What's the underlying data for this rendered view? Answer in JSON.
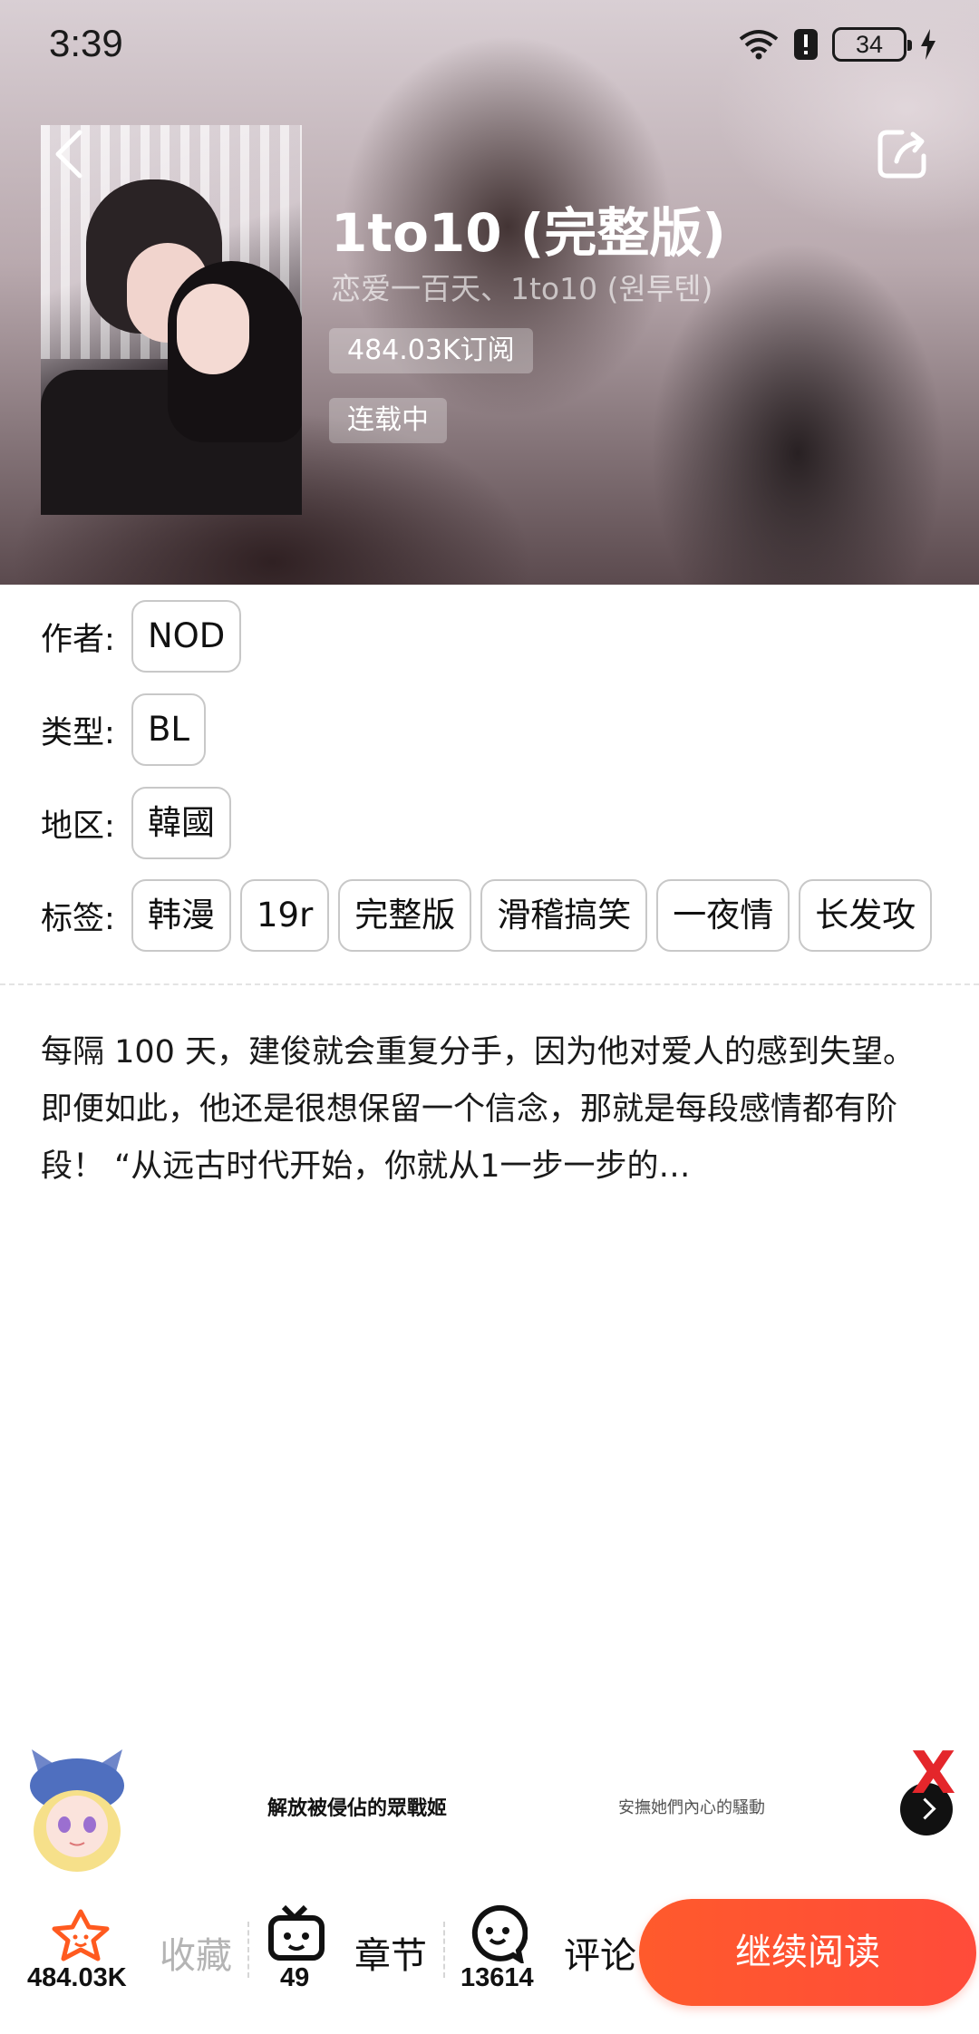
{
  "status_bar": {
    "time": "3:39",
    "battery": "34"
  },
  "header": {
    "title": "1to10 (完整版)",
    "alt_titles": "恋爱一百天、1to10 (원투텐)",
    "subscriptions": "484.03K订阅",
    "status": "连载中",
    "back_icon": "chevron-left-icon",
    "share_icon": "share-icon"
  },
  "meta": {
    "author_label": "作者:",
    "author": "NOD",
    "type_label": "类型:",
    "type": "BL",
    "region_label": "地区:",
    "region": "韓國",
    "tags_label": "标签:",
    "tags": [
      "韩漫",
      "19r",
      "完整版",
      "滑稽搞笑",
      "一夜情",
      "长发攻"
    ]
  },
  "description": "每隔 100 天，建俊就会重复分手，因为他对爱人的感到失望。 即便如此，他还是很想保留一个信念，那就是每段感情都有阶段！ “从远古时代开始，你就从1一步一步的…",
  "ad": {
    "title": "解放被侵佔的眾戰姬",
    "subtitle": "安撫她們內心的騷動",
    "close_glyph": "X"
  },
  "bottom_bar": {
    "favorite_count": "484.03K",
    "favorite_label": "收藏",
    "chapters_count": "49",
    "chapters_label": "章节",
    "comments_count": "13614",
    "comments_label": "评论",
    "continue_label": "继续阅读"
  },
  "colors": {
    "accent": "#ff5a2c",
    "favorite_icon": "#ff5a1f",
    "ad_close": "#e4262b"
  }
}
